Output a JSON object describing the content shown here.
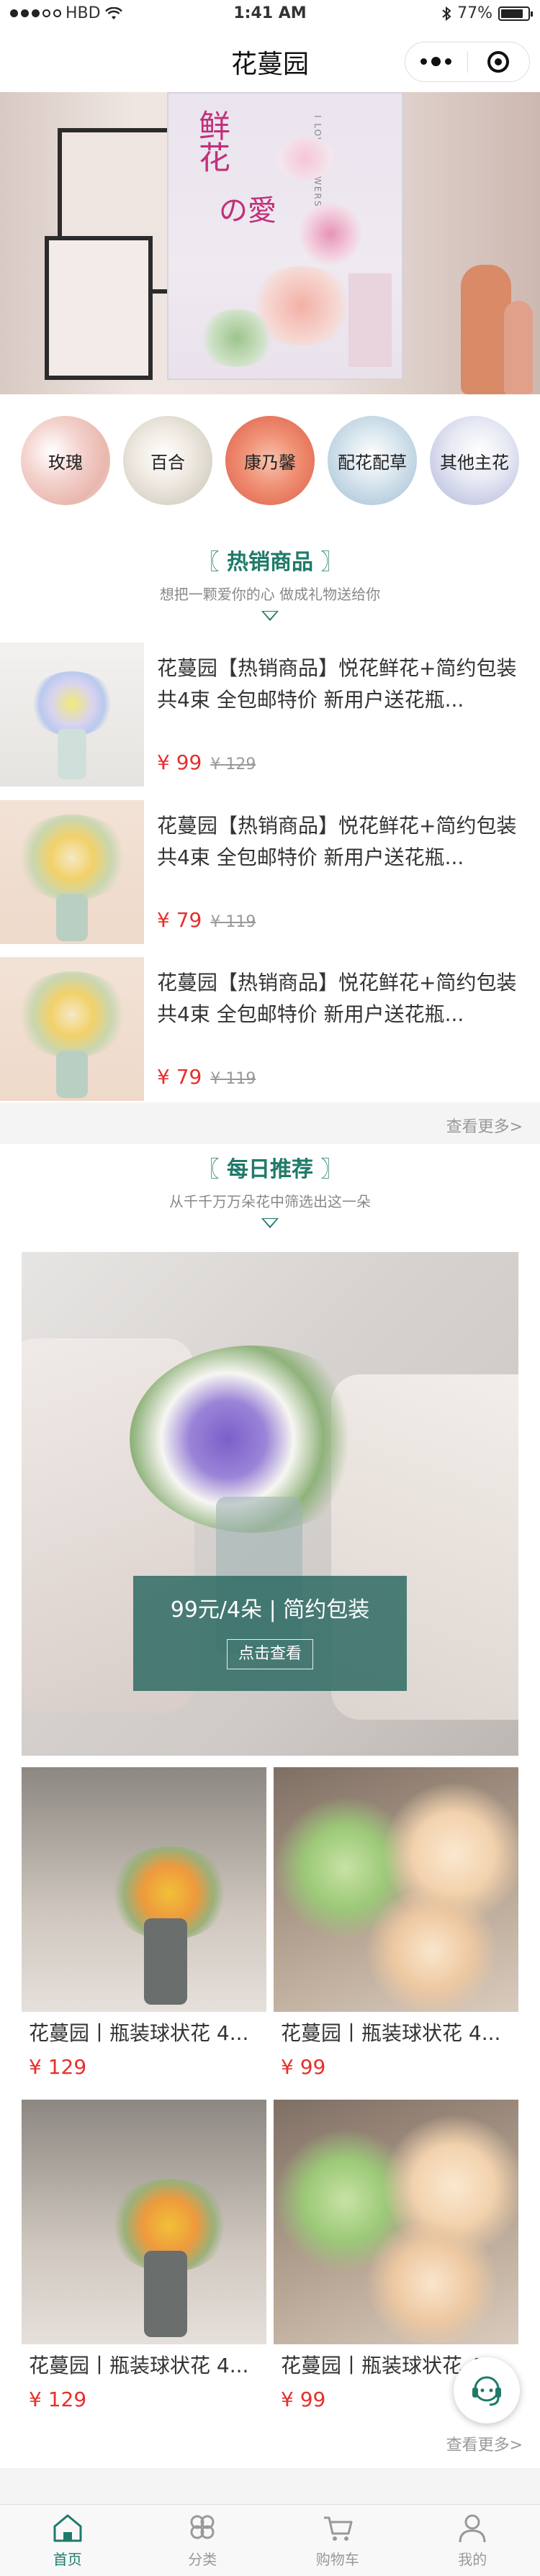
{
  "status_bar": {
    "carrier": "HBD",
    "time": "1:41 AM",
    "battery": "77%"
  },
  "nav": {
    "title": "花蔓园"
  },
  "banner": {
    "poster_title": "鲜花",
    "poster_sub": "の愛",
    "poster_en": "I LOVE FLOWERS",
    "slides": 3,
    "active_slide": 1
  },
  "categories": [
    {
      "label": "玫瑰",
      "color": "#f2cbc6"
    },
    {
      "label": "百合",
      "color": "#e9e4dc"
    },
    {
      "label": "康乃馨",
      "color": "#f0a58b"
    },
    {
      "label": "配花配草",
      "color": "#c9d9e6"
    },
    {
      "label": "其他主花",
      "color": "#dfe2ef"
    }
  ],
  "hot": {
    "title_left": "〖",
    "title": "热销商品",
    "title_right": "〗",
    "subtitle": "想把一颗爱你的心 做成礼物送给你",
    "items": [
      {
        "name": "花蔓园【热销商品】悦花鲜花+简约包装共4束 全包邮特价 新用户送花瓶...",
        "price": "¥ 99",
        "old_price": "¥ 129"
      },
      {
        "name": "花蔓园【热销商品】悦花鲜花+简约包装共4束 全包邮特价 新用户送花瓶...",
        "price": "¥ 79",
        "old_price": "¥ 119"
      },
      {
        "name": "花蔓园【热销商品】悦花鲜花+简约包装共4束 全包邮特价 新用户送花瓶...",
        "price": "¥ 79",
        "old_price": "¥ 119"
      }
    ],
    "more": "查看更多>"
  },
  "daily": {
    "title_left": "〖",
    "title": "每日推荐",
    "title_right": "〗",
    "subtitle": "从千千万万朵花中筛选出这一朵",
    "hero_text": "99元/4朵 | 简约包装",
    "hero_button": "点击查看",
    "cards": [
      {
        "name": "花蔓园丨瓶装球状花 4...",
        "price": "¥ 129"
      },
      {
        "name": "花蔓园丨瓶装球状花 4...",
        "price": "¥ 99"
      },
      {
        "name": "花蔓园丨瓶装球状花 4...",
        "price": "¥ 129"
      },
      {
        "name": "花蔓园丨瓶装球状花 4...",
        "price": "¥ 99"
      }
    ],
    "more": "查看更多>"
  },
  "tabbar": [
    {
      "label": "首页",
      "icon": "home-icon",
      "active": true
    },
    {
      "label": "分类",
      "icon": "category-icon",
      "active": false
    },
    {
      "label": "购物车",
      "icon": "cart-icon",
      "active": false
    },
    {
      "label": "我的",
      "icon": "user-icon",
      "active": false
    }
  ],
  "accent": "#1f7a6a",
  "price_color": "#e5302c"
}
